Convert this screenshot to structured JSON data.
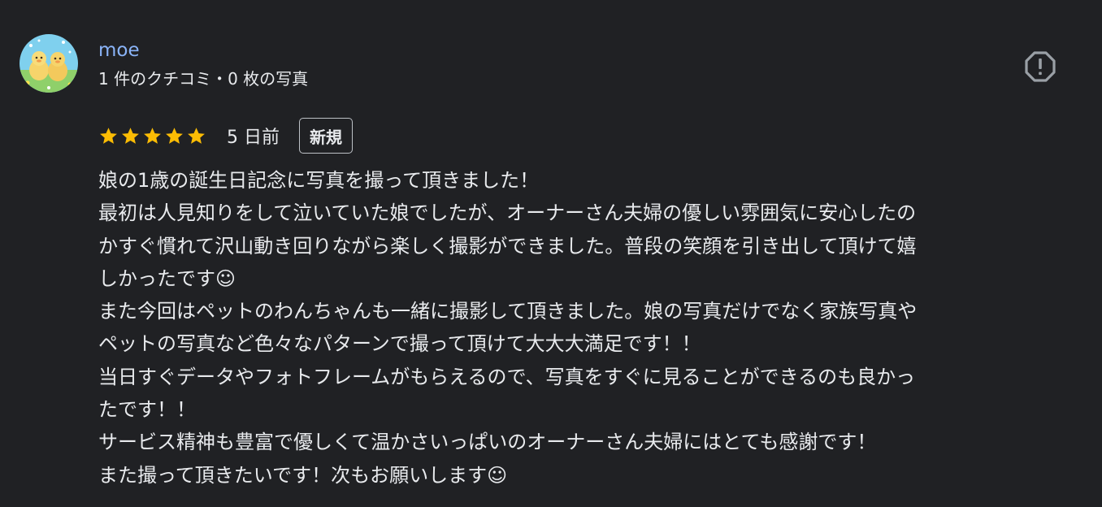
{
  "author": {
    "name": "moe",
    "meta": "1 件のクチコミ・0 枚の写真",
    "avatar_icon": "ducklings-avatar"
  },
  "report": {
    "icon": "report-flag-icon"
  },
  "rating": {
    "stars": 5,
    "max": 5,
    "star_color": "#fbbc04",
    "date": "5 日前",
    "badge": "新規"
  },
  "review": {
    "lines": [
      "娘の1歳の誕生日記念に写真を撮って頂きました！",
      "最初は人見知りをして泣いていた娘でしたが、オーナーさん夫婦の優しい雰囲気に安心したの",
      "かすぐ慣れて沢山動き回りながら楽しく撮影ができました。普段の笑顔を引き出して頂けて嬉",
      "しかったです☺︎",
      "また今回はペットのわんちゃんも一緒に撮影して頂きました。娘の写真だけでなく家族写真や",
      "ペットの写真など色々なパターンで撮って頂けて大大大満足です！！",
      "当日すぐデータやフォトフレームがもらえるので、写真をすぐに見ることができるのも良かっ",
      "たです！！",
      "サービス精神も豊富で優しくて温かさいっぱいのオーナーさん夫婦にはとても感謝です！",
      "また撮って頂きたいです！次もお願いします☺︎"
    ]
  },
  "colors": {
    "background": "#202124",
    "text": "#e8eaed",
    "author_link": "#8ab4f8",
    "icon_gray": "#9aa0a6"
  }
}
